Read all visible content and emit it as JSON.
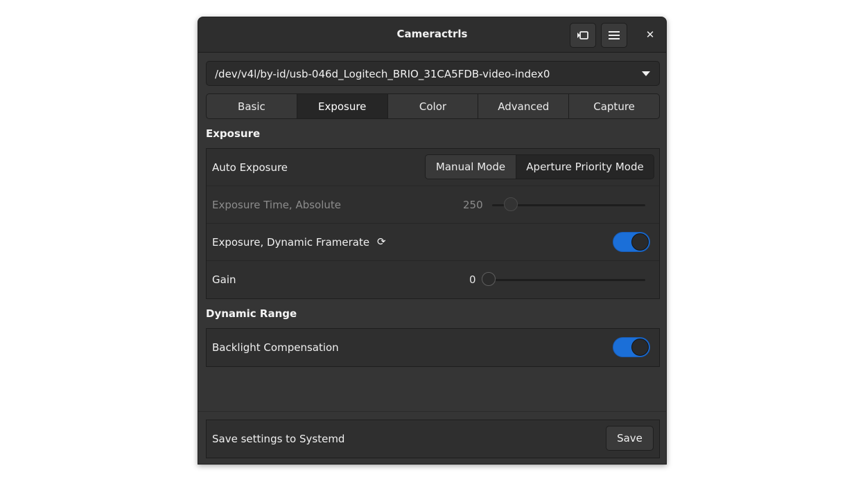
{
  "window": {
    "title": "Cameractrls"
  },
  "header": {
    "preview_icon": "camera-preview-icon",
    "menu_icon": "hamburger-menu-icon",
    "close_glyph": "✕"
  },
  "device": {
    "selected": "/dev/v4l/by-id/usb-046d_Logitech_BRIO_31CA5FDB-video-index0"
  },
  "tabs": [
    {
      "label": "Basic",
      "active": false
    },
    {
      "label": "Exposure",
      "active": true
    },
    {
      "label": "Color",
      "active": false
    },
    {
      "label": "Advanced",
      "active": false
    },
    {
      "label": "Capture",
      "active": false
    }
  ],
  "sections": {
    "exposure": {
      "title": "Exposure",
      "auto_exposure": {
        "label": "Auto Exposure",
        "options": [
          "Manual Mode",
          "Aperture Priority Mode"
        ],
        "selected": "Aperture Priority Mode"
      },
      "exposure_time": {
        "label": "Exposure Time, Absolute",
        "value": "250",
        "fraction": 0.12,
        "disabled": true
      },
      "dynamic_framerate": {
        "label": "Exposure, Dynamic Framerate",
        "refresh_glyph": "⟳",
        "on": true
      },
      "gain": {
        "label": "Gain",
        "value": "0",
        "fraction": 0.0
      }
    },
    "dynamic_range": {
      "title": "Dynamic Range",
      "backlight": {
        "label": "Backlight Compensation",
        "on": true
      }
    }
  },
  "footer": {
    "label": "Save settings to Systemd",
    "save_label": "Save"
  },
  "colors": {
    "accent": "#1b6fd8",
    "window_bg": "#353535",
    "header_bg": "#2e2e2e"
  }
}
